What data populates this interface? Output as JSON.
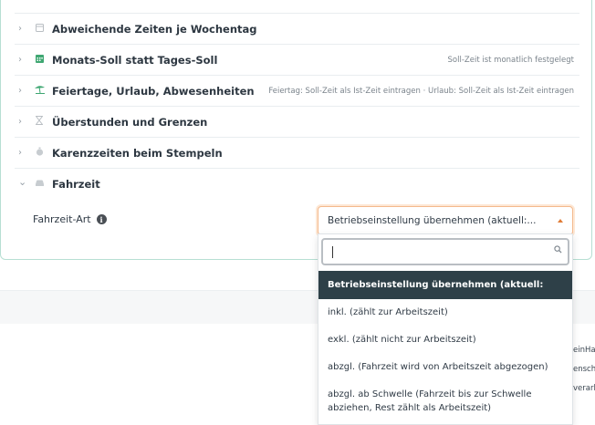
{
  "settings": {
    "rows": [
      {
        "title": "Abweichende Zeiten je Wochentag",
        "icon": "calendar-icon",
        "chevron": "›",
        "hint": ""
      },
      {
        "title": "Monats-Soll statt Tages-Soll",
        "icon": "calendar-grid-icon",
        "chevron": "›",
        "hint": "Soll-Zeit ist monatlich festgelegt"
      },
      {
        "title": "Feiertage, Urlaub, Abwesenheiten",
        "icon": "beach-umbrella-icon",
        "chevron": "›",
        "hint": "Feiertag: Soll-Zeit als Ist-Zeit eintragen · Urlaub: Soll-Zeit als Ist-Zeit eintragen"
      },
      {
        "title": "Überstunden und Grenzen",
        "icon": "hourglass-icon",
        "chevron": "›",
        "hint": ""
      },
      {
        "title": "Karenzzeiten beim Stempeln",
        "icon": "stopwatch-icon",
        "chevron": "›",
        "hint": ""
      },
      {
        "title": "Fahrzeit",
        "icon": "car-icon",
        "chevron": "⌄",
        "hint": ""
      }
    ]
  },
  "fahrzeit": {
    "label": "Fahrzeit-Art",
    "info_glyph": "i",
    "selected_value": "Betriebseinstellung übernehmen (aktuell:...",
    "search_value": "",
    "options": [
      "Betriebseinstellung übernehmen (aktuell: inkl.)",
      "inkl. (zählt zur Arbeitszeit)",
      "exkl. (zählt nicht zur Arbeitszeit)",
      "abzgl. (Fahrzeit wird von Arbeitszeit abgezogen)",
      "abzgl. ab Schwelle (Fahrzeit bis zur Schwelle abziehen, Rest zählt als Arbeitszeit)"
    ],
    "selected_index": 0
  },
  "peek_text": [
    "einHa",
    "ensch",
    "verarl"
  ],
  "colors": {
    "accent": "#e07b35",
    "selected_option_bg": "#2e4048",
    "card_border": "#b7dfd3",
    "calendar_green": "#3fa772"
  }
}
